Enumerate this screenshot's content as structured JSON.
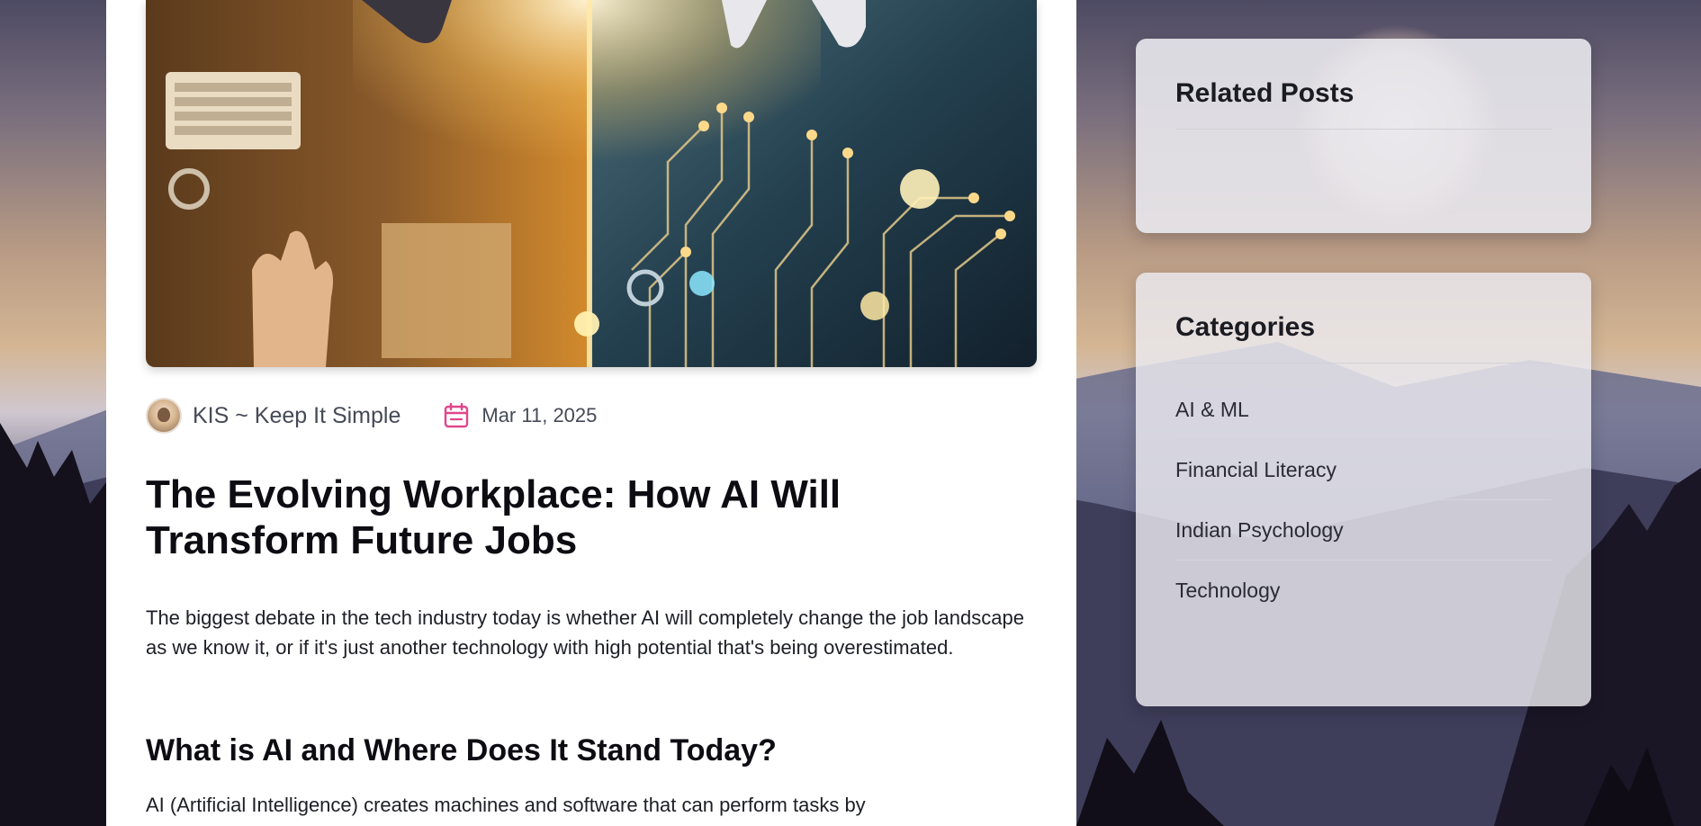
{
  "meta": {
    "author": "KIS ~ Keep It Simple",
    "date": "Mar 11, 2025"
  },
  "article": {
    "title": "The Evolving Workplace: How AI Will Transform Future Jobs",
    "intro": "The biggest debate in the tech industry today is whether AI will completely change the job landscape as we know it, or if it's just another technology with high potential that's being overestimated.",
    "section_heading": "What is AI and Where Does It Stand Today?",
    "section_text": "AI (Artificial Intelligence) creates machines and software that can perform tasks by"
  },
  "sidebar": {
    "related_title": "Related Posts",
    "categories_title": "Categories",
    "categories": [
      "AI & ML",
      "Financial Literacy",
      "Indian Psychology",
      "Technology"
    ]
  }
}
